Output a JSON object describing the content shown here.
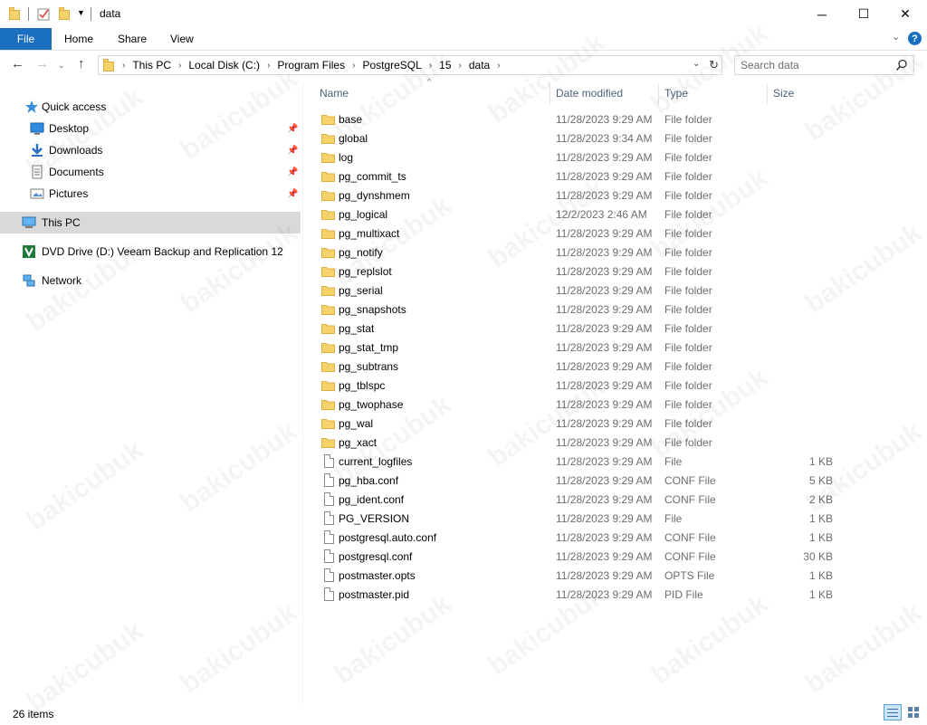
{
  "window": {
    "title": "data",
    "controls": {
      "minimize": "─",
      "maximize": "☐",
      "close": "✕"
    }
  },
  "ribbon": {
    "tabs": [
      {
        "label": "File",
        "active": true
      },
      {
        "label": "Home"
      },
      {
        "label": "Share"
      },
      {
        "label": "View"
      }
    ],
    "accent_color": "#1a6fc0"
  },
  "address_bar": {
    "breadcrumbs": [
      "This PC",
      "Local Disk (C:)",
      "Program Files",
      "PostgreSQL",
      "15",
      "data"
    ]
  },
  "search": {
    "placeholder": "Search data"
  },
  "nav_pane": {
    "quick_access": {
      "label": "Quick access"
    },
    "pinned": [
      {
        "label": "Desktop",
        "icon": "desktop-icon"
      },
      {
        "label": "Downloads",
        "icon": "download-arrow-icon"
      },
      {
        "label": "Documents",
        "icon": "document-icon"
      },
      {
        "label": "Pictures",
        "icon": "picture-icon"
      }
    ],
    "this_pc": {
      "label": "This PC"
    },
    "dvd": {
      "label": "DVD Drive (D:) Veeam Backup and Replication 12"
    },
    "network": {
      "label": "Network"
    }
  },
  "columns": {
    "name": "Name",
    "date": "Date modified",
    "type": "Type",
    "size": "Size"
  },
  "files": [
    {
      "name": "base",
      "date": "11/28/2023 9:29 AM",
      "type": "File folder",
      "size": "",
      "kind": "folder"
    },
    {
      "name": "global",
      "date": "11/28/2023 9:34 AM",
      "type": "File folder",
      "size": "",
      "kind": "folder"
    },
    {
      "name": "log",
      "date": "11/28/2023 9:29 AM",
      "type": "File folder",
      "size": "",
      "kind": "folder"
    },
    {
      "name": "pg_commit_ts",
      "date": "11/28/2023 9:29 AM",
      "type": "File folder",
      "size": "",
      "kind": "folder"
    },
    {
      "name": "pg_dynshmem",
      "date": "11/28/2023 9:29 AM",
      "type": "File folder",
      "size": "",
      "kind": "folder"
    },
    {
      "name": "pg_logical",
      "date": "12/2/2023 2:46 AM",
      "type": "File folder",
      "size": "",
      "kind": "folder"
    },
    {
      "name": "pg_multixact",
      "date": "11/28/2023 9:29 AM",
      "type": "File folder",
      "size": "",
      "kind": "folder"
    },
    {
      "name": "pg_notify",
      "date": "11/28/2023 9:29 AM",
      "type": "File folder",
      "size": "",
      "kind": "folder"
    },
    {
      "name": "pg_replslot",
      "date": "11/28/2023 9:29 AM",
      "type": "File folder",
      "size": "",
      "kind": "folder"
    },
    {
      "name": "pg_serial",
      "date": "11/28/2023 9:29 AM",
      "type": "File folder",
      "size": "",
      "kind": "folder"
    },
    {
      "name": "pg_snapshots",
      "date": "11/28/2023 9:29 AM",
      "type": "File folder",
      "size": "",
      "kind": "folder"
    },
    {
      "name": "pg_stat",
      "date": "11/28/2023 9:29 AM",
      "type": "File folder",
      "size": "",
      "kind": "folder"
    },
    {
      "name": "pg_stat_tmp",
      "date": "11/28/2023 9:29 AM",
      "type": "File folder",
      "size": "",
      "kind": "folder"
    },
    {
      "name": "pg_subtrans",
      "date": "11/28/2023 9:29 AM",
      "type": "File folder",
      "size": "",
      "kind": "folder"
    },
    {
      "name": "pg_tblspc",
      "date": "11/28/2023 9:29 AM",
      "type": "File folder",
      "size": "",
      "kind": "folder"
    },
    {
      "name": "pg_twophase",
      "date": "11/28/2023 9:29 AM",
      "type": "File folder",
      "size": "",
      "kind": "folder"
    },
    {
      "name": "pg_wal",
      "date": "11/28/2023 9:29 AM",
      "type": "File folder",
      "size": "",
      "kind": "folder"
    },
    {
      "name": "pg_xact",
      "date": "11/28/2023 9:29 AM",
      "type": "File folder",
      "size": "",
      "kind": "folder"
    },
    {
      "name": "current_logfiles",
      "date": "11/28/2023 9:29 AM",
      "type": "File",
      "size": "1 KB",
      "kind": "file"
    },
    {
      "name": "pg_hba.conf",
      "date": "11/28/2023 9:29 AM",
      "type": "CONF File",
      "size": "5 KB",
      "kind": "file"
    },
    {
      "name": "pg_ident.conf",
      "date": "11/28/2023 9:29 AM",
      "type": "CONF File",
      "size": "2 KB",
      "kind": "file"
    },
    {
      "name": "PG_VERSION",
      "date": "11/28/2023 9:29 AM",
      "type": "File",
      "size": "1 KB",
      "kind": "file"
    },
    {
      "name": "postgresql.auto.conf",
      "date": "11/28/2023 9:29 AM",
      "type": "CONF File",
      "size": "1 KB",
      "kind": "file"
    },
    {
      "name": "postgresql.conf",
      "date": "11/28/2023 9:29 AM",
      "type": "CONF File",
      "size": "30 KB",
      "kind": "file"
    },
    {
      "name": "postmaster.opts",
      "date": "11/28/2023 9:29 AM",
      "type": "OPTS File",
      "size": "1 KB",
      "kind": "file"
    },
    {
      "name": "postmaster.pid",
      "date": "11/28/2023 9:29 AM",
      "type": "PID File",
      "size": "1 KB",
      "kind": "file"
    }
  ],
  "status": {
    "item_count": "26 items"
  },
  "watermark": {
    "text": "bakicubuk"
  }
}
